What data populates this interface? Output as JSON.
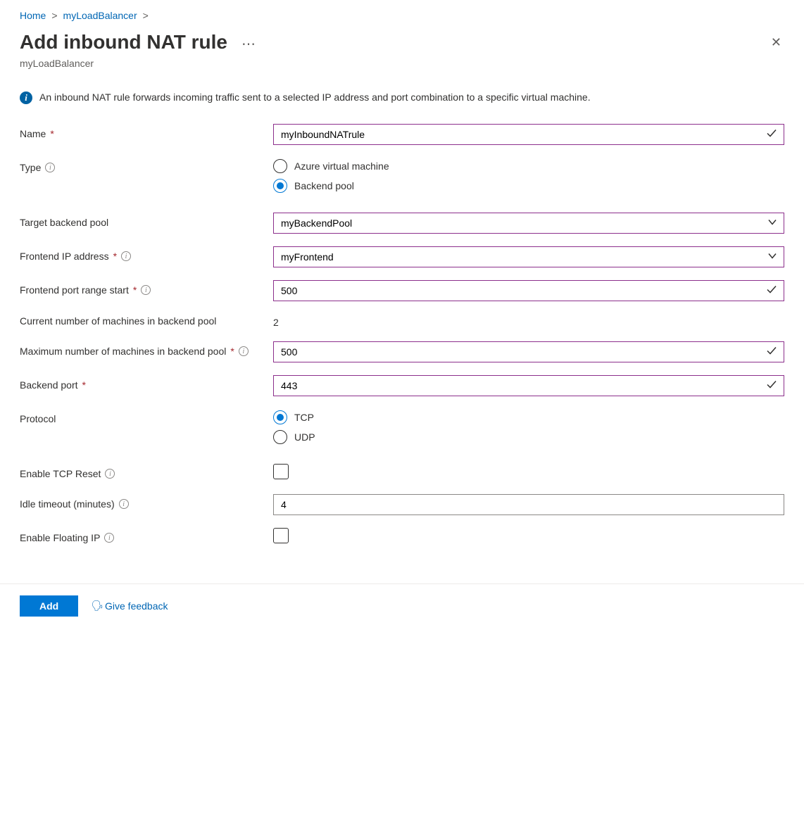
{
  "breadcrumb": {
    "home": "Home",
    "resource": "myLoadBalancer"
  },
  "header": {
    "title": "Add inbound NAT rule",
    "subtitle": "myLoadBalancer"
  },
  "info": {
    "text": "An inbound NAT rule forwards incoming traffic sent to a selected IP address and port combination to a specific virtual machine."
  },
  "fields": {
    "name": {
      "label": "Name",
      "value": "myInboundNATrule"
    },
    "type": {
      "label": "Type",
      "options": [
        "Azure virtual machine",
        "Backend pool"
      ],
      "selected": "Backend pool"
    },
    "targetBackendPool": {
      "label": "Target backend pool",
      "value": "myBackendPool"
    },
    "frontendIp": {
      "label": "Frontend IP address",
      "value": "myFrontend"
    },
    "frontendPortStart": {
      "label": "Frontend port range start",
      "value": "500"
    },
    "currentMachines": {
      "label": "Current number of machines in backend pool",
      "value": "2"
    },
    "maxMachines": {
      "label": "Maximum number of machines in backend pool",
      "value": "500"
    },
    "backendPort": {
      "label": "Backend port",
      "value": "443"
    },
    "protocol": {
      "label": "Protocol",
      "options": [
        "TCP",
        "UDP"
      ],
      "selected": "TCP"
    },
    "tcpReset": {
      "label": "Enable TCP Reset",
      "checked": false
    },
    "idleTimeout": {
      "label": "Idle timeout (minutes)",
      "value": "4"
    },
    "floatingIp": {
      "label": "Enable Floating IP",
      "checked": false
    }
  },
  "footer": {
    "add": "Add",
    "feedback": "Give feedback"
  }
}
